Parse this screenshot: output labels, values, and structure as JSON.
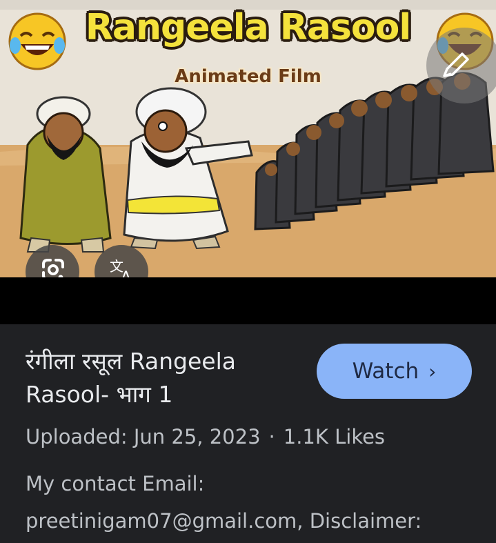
{
  "thumbnail": {
    "title_text": "Rangeela Rasool",
    "subtitle_text": "Animated Film"
  },
  "result": {
    "title": "रंगीला रसूल Rangeela Rasool- भाग 1",
    "watch_label": "Watch",
    "watch_chevron": "›",
    "uploaded": "Uploaded: Jun 25, 2023",
    "separator": "·",
    "likes": "1.1K Likes",
    "description": "My contact Email: preetinigam07@gmail.com, Disclaimer:"
  },
  "icons": {
    "edit": "pencil-edit-icon",
    "lens": "google-lens-icon",
    "translate": "translate-icon",
    "emoji": "laughing-face-emoji"
  },
  "colors": {
    "background": "#202124",
    "button": "#8ab4f8",
    "title_text": "#e8eaed",
    "meta_text": "#bdc1c6"
  }
}
